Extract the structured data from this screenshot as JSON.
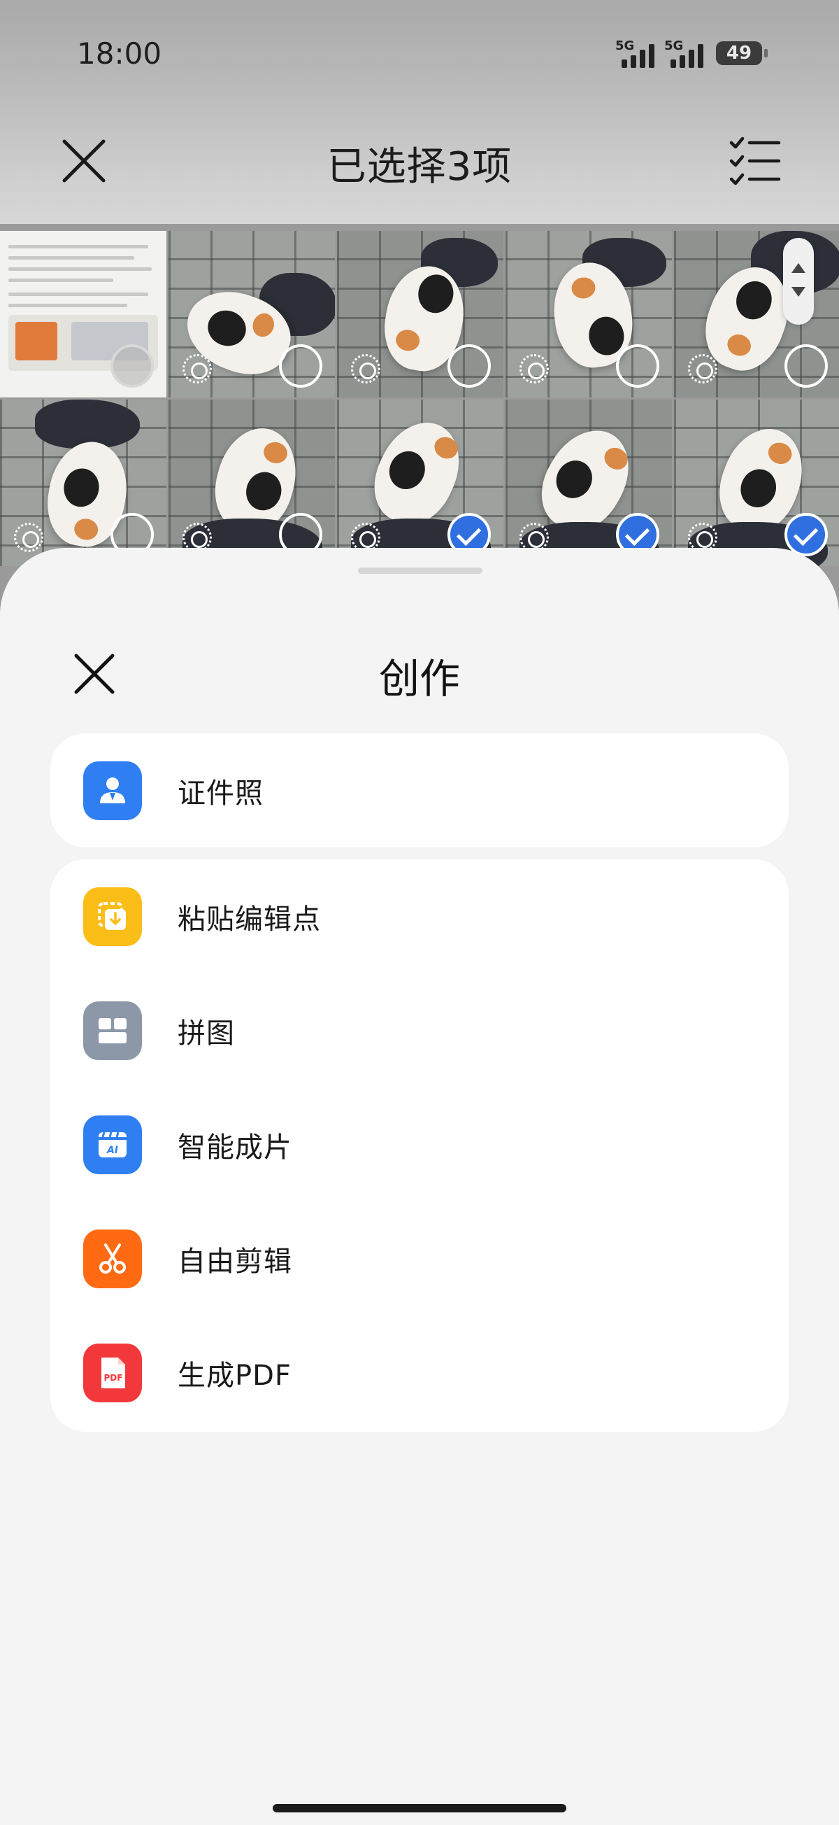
{
  "status_bar": {
    "time": "18:00",
    "network_1": "5G",
    "network_2": "5G",
    "battery": "49"
  },
  "topbar": {
    "title": "已选择3项",
    "close_icon": "close-icon",
    "select_all_icon": "checklist-icon"
  },
  "grid": {
    "selected_count": 3,
    "check_color": "#2f6fe0"
  },
  "sheet": {
    "title": "创作",
    "close_icon": "close-icon",
    "card1": [
      {
        "label": "证件照",
        "icon": "id-photo-icon",
        "color": "#2f7ff2"
      }
    ],
    "card2": [
      {
        "label": "粘贴编辑点",
        "icon": "paste-edit-icon",
        "color": "#fbbd18"
      },
      {
        "label": "拼图",
        "icon": "collage-icon",
        "color": "#8c98a8"
      },
      {
        "label": "智能成片",
        "icon": "ai-movie-icon",
        "color": "#2f7ff2"
      },
      {
        "label": "自由剪辑",
        "icon": "scissors-icon",
        "color": "#ff6a13"
      },
      {
        "label": "生成PDF",
        "icon": "pdf-icon",
        "color": "#f2383a",
        "icon_text": "PDF"
      }
    ]
  }
}
